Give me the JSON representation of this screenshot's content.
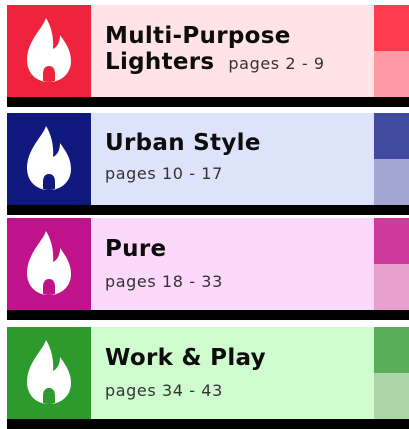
{
  "sections": [
    {
      "title_line1": "Multi-Purpose",
      "title_line2": "Lighters",
      "pages": "pages 2 - 9",
      "colors": {
        "primary": "#f0233e",
        "body": "#ffe3e6",
        "swatch_top": "#ff3b52",
        "swatch_bottom": "#ff99a6"
      },
      "icon": "flame-icon"
    },
    {
      "title": "Urban Style",
      "pages": "pages 10 - 17",
      "colors": {
        "primary": "#101a7e",
        "body": "#dde3fb",
        "swatch_top": "#404a9e",
        "swatch_bottom": "#a3a8d2"
      },
      "icon": "flame-icon"
    },
    {
      "title": "Pure",
      "pages": "pages 18 - 33",
      "colors": {
        "primary": "#c0128a",
        "body": "#fcd8fa",
        "swatch_top": "#cd3a9c",
        "swatch_bottom": "#e79fcd"
      },
      "icon": "flame-icon"
    },
    {
      "title": "Work & Play",
      "pages": "pages 34 - 43",
      "colors": {
        "primary": "#2c9a2c",
        "body": "#cffccf",
        "swatch_top": "#59ad59",
        "swatch_bottom": "#acd6a8"
      },
      "icon": "flame-icon"
    }
  ]
}
